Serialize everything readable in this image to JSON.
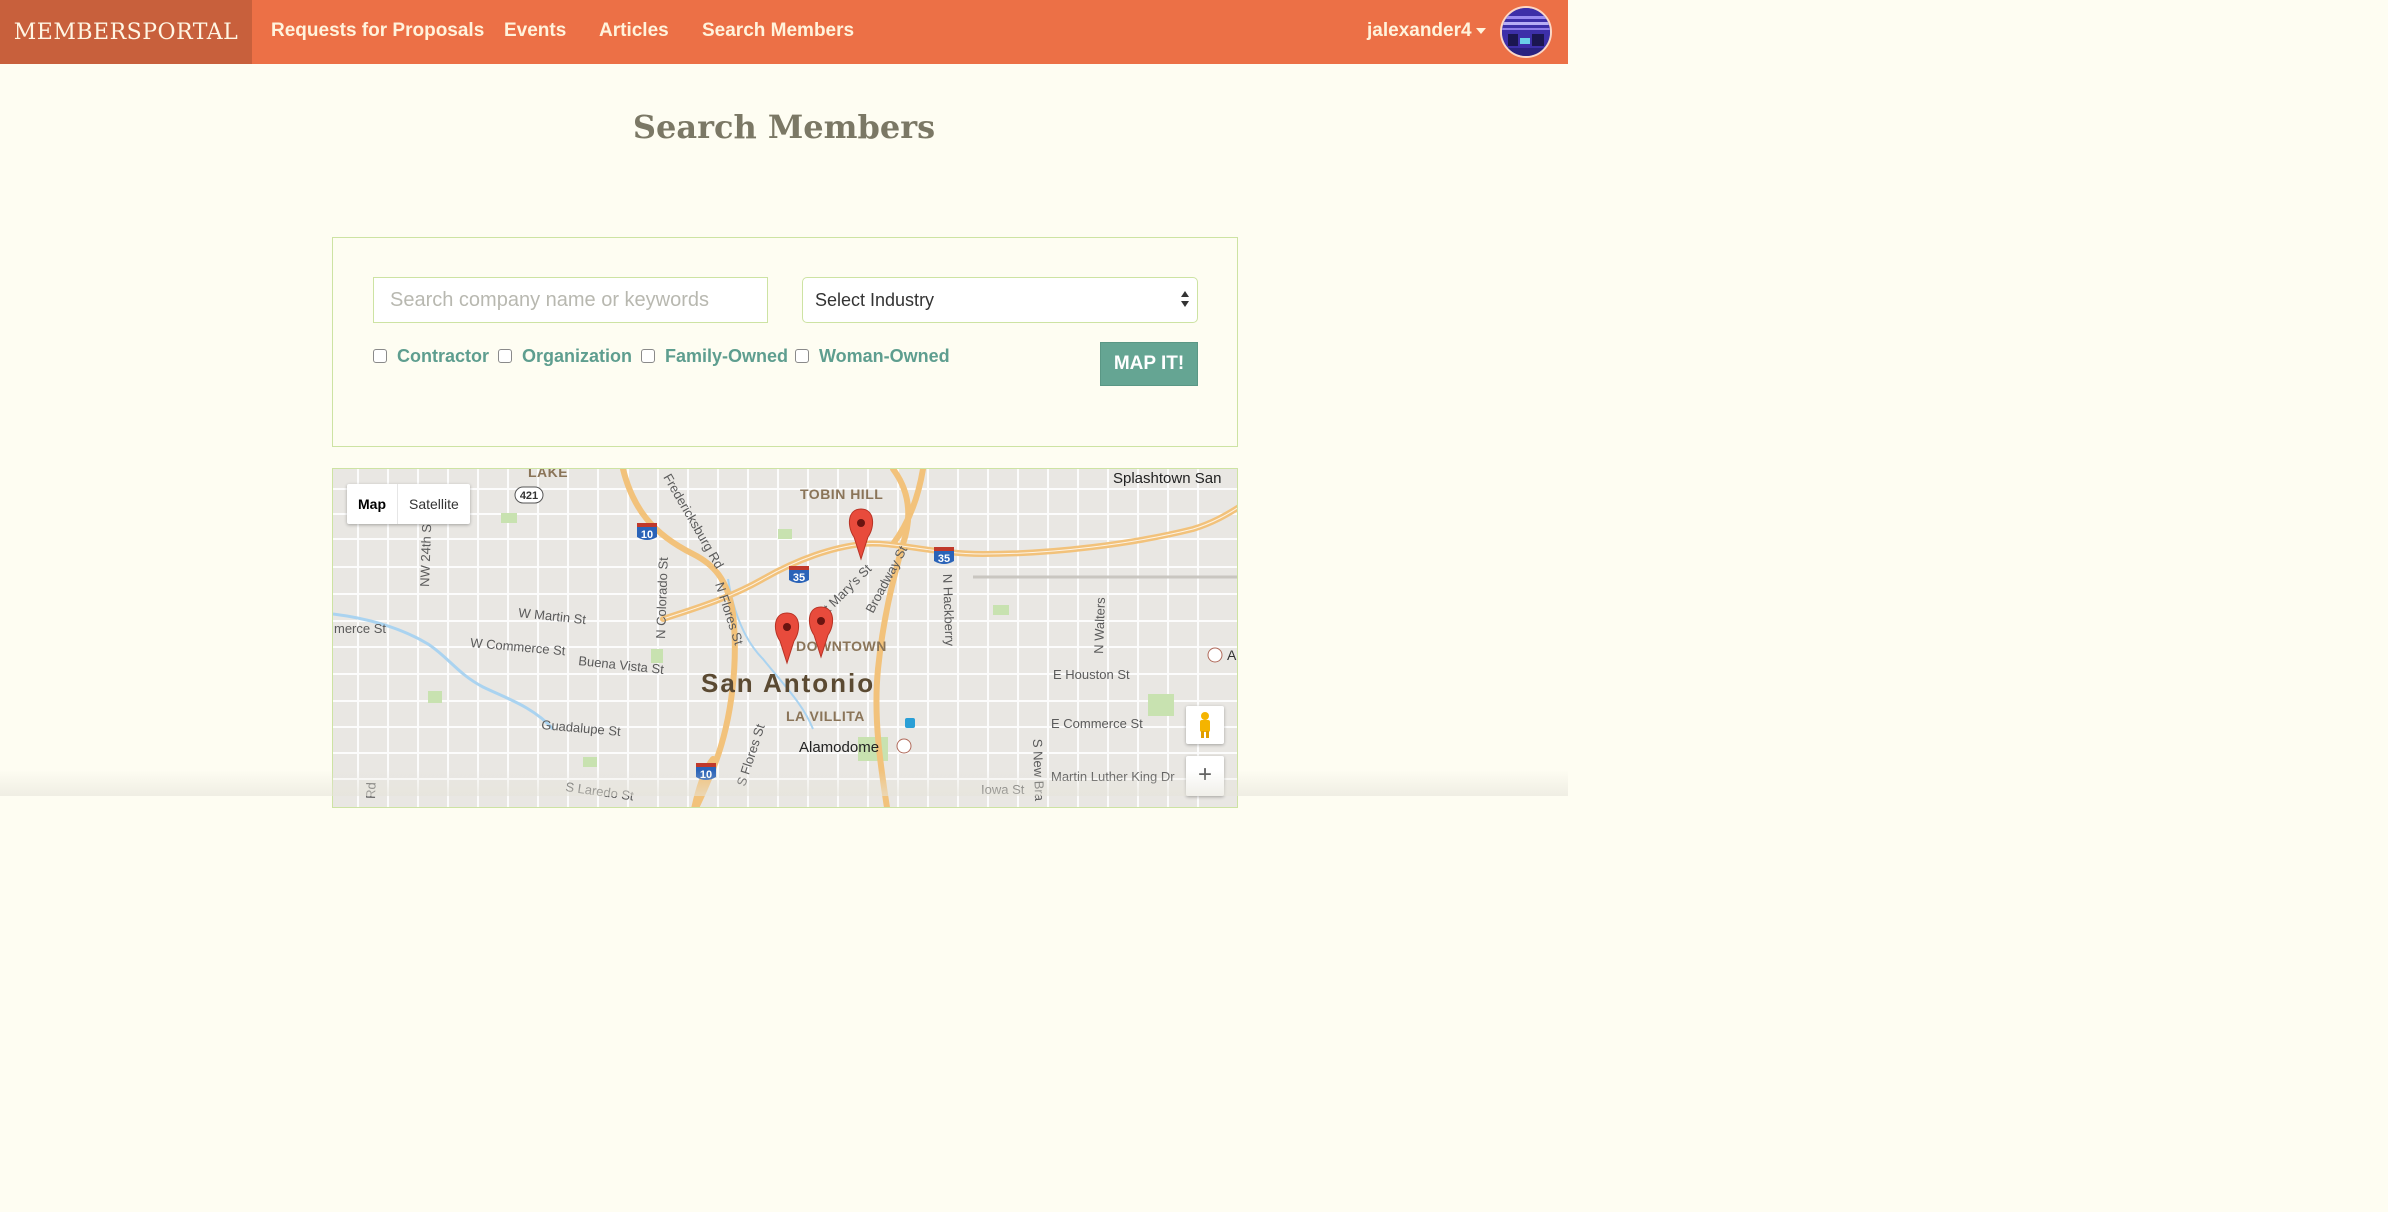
{
  "nav": {
    "brand": "MEMBERSPORTAL",
    "links": [
      "Requests for Proposals",
      "Events",
      "Articles",
      "Search Members"
    ],
    "username": "jalexander4"
  },
  "page": {
    "title": "Search Members"
  },
  "search": {
    "placeholder": "Search company name or keywords",
    "industry_selected": "Select Industry",
    "filters": [
      "Contractor",
      "Organization",
      "Family-Owned",
      "Woman-Owned"
    ],
    "submit_label": "MAP IT!"
  },
  "map": {
    "type_options": [
      "Map",
      "Satellite"
    ],
    "selected_type": "Map",
    "zoom_in_label": "+",
    "city_label": "San Antonio",
    "district_labels": [
      "LAKE",
      "TOBIN HILL",
      "DOWNTOWN",
      "LA VILLITA"
    ],
    "place_labels": [
      "Splashtown San",
      "Alamodome"
    ],
    "street_labels": [
      "NW 24th St",
      "W Martin St",
      "W Commerce St",
      "Buena Vista St",
      "Guadalupe St",
      "S Laredo St",
      "N Colorado St",
      "N Flores St",
      "S Flores St",
      "St Mary's St",
      "Broadway St",
      "N Hackberry",
      "N Walters",
      "E Houston St",
      "E Commerce St",
      "Martin Luther King Dr",
      "Iowa St",
      "S New Bra",
      "Rd",
      "Fredericksburg Rd",
      "merce St"
    ],
    "highway_shields": [
      "421",
      "10",
      "35",
      "35",
      "10"
    ],
    "marker_count": 3
  },
  "colors": {
    "nav_bg": "#ec7046",
    "brand_bg": "#c8603c",
    "page_bg": "#fefdf2",
    "accent_teal": "#65a593",
    "panel_border": "#cde3a3",
    "marker_red": "#e84b3c"
  }
}
